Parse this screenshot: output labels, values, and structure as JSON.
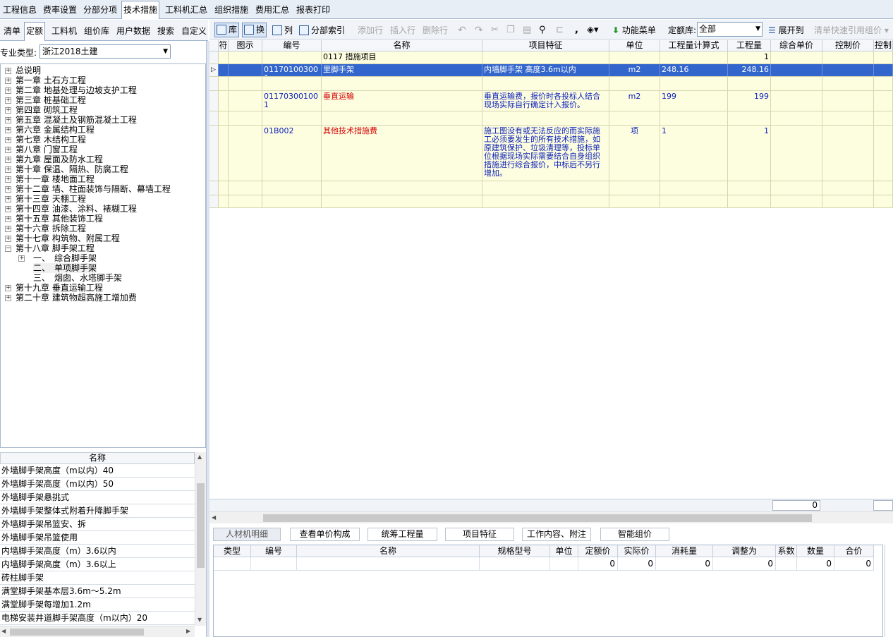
{
  "top_tabs": [
    "工程信息",
    "费率设置",
    "分部分项",
    "技术措施",
    "工料机汇总",
    "组织措施",
    "费用汇总",
    "报表打印"
  ],
  "left_tabs": [
    "清单",
    "定额",
    "工料机",
    "组价库",
    "用户数据",
    "搜索",
    "自定义"
  ],
  "specialty": {
    "label": "专业类型:",
    "value": "浙江2018土建"
  },
  "tree_items": [
    "总说明",
    "第一章 土石方工程",
    "第二章 地基处理与边坡支护工程",
    "第三章 桩基础工程",
    "第四章 砌筑工程",
    "第五章 混凝土及钢筋混凝土工程",
    "第六章 金属结构工程",
    "第七章 木结构工程",
    "第八章 门窗工程",
    "第九章 屋面及防水工程",
    "第十章 保温、隔热、防腐工程",
    "第十一章 楼地面工程",
    "第十二章 墙、柱面装饰与隔断、幕墙工程",
    "第十三章 天棚工程",
    "第十四章 油漆、涂料、裱糊工程",
    "第十五章 其他装饰工程",
    "第十六章 拆除工程",
    "第十七章 构筑物、附属工程",
    "第十八章 脚手架工程",
    "一、　综合脚手架",
    "二、　单项脚手架",
    "三、　烟囱、水塔脚手架",
    "第十九章 垂直运输工程",
    "第二十章 建筑物超高施工增加费"
  ],
  "list_header": "名称",
  "list_items": [
    "外墙脚手架高度（m以内）40",
    "外墙脚手架高度（m以内）50",
    "外墙脚手架悬挑式",
    "外墙脚手架整体式附着升降脚手架",
    "外墙脚手架吊篮安、拆",
    "外墙脚手架吊篮使用",
    "内墙脚手架高度（m）3.6以内",
    "内墙脚手架高度（m）3.6以上",
    "砖柱脚手架",
    "满堂脚手架基本层3.6m～5.2m",
    "满堂脚手架每增加1.2m",
    "电梯安装井道脚手架高度（m以内）20"
  ],
  "toolbar": {
    "ku": "库",
    "huan": "换",
    "lie": "列",
    "fenbu": "分部索引",
    "add": "添加行",
    "insert": "插入行",
    "delete": "删除行",
    "func": "功能菜单",
    "deku_label": "定额库:",
    "deku_value": "全部",
    "expand": "展开到",
    "quick": "清单快速引用组价"
  },
  "grid_headers": [
    "符",
    "图示",
    "编号",
    "名称",
    "项目特征",
    "单位",
    "工程量计算式",
    "工程量",
    "综合单价",
    "控制价",
    "控制"
  ],
  "grid_rows": [
    {
      "code": "",
      "name": "0117 措施项目",
      "feature": "",
      "unit": "",
      "formula": "",
      "qty": "1"
    },
    {
      "code": "011701003001",
      "name": "里脚手架",
      "feature": "内墙脚手架 高度3.6m以内",
      "unit": "m2",
      "formula": "248.16",
      "qty": "248.16"
    },
    {
      "code": "",
      "name": "",
      "feature": "",
      "unit": "",
      "formula": "",
      "qty": ""
    },
    {
      "code": "011703001001",
      "name": "垂直运输",
      "feature": "垂直运输费，报价时各投标人结合现场实际自行确定计入报价。",
      "unit": "m2",
      "formula": "199",
      "qty": "199"
    },
    {
      "code": "",
      "name": "",
      "feature": "",
      "unit": "",
      "formula": "",
      "qty": ""
    },
    {
      "code": "01B002",
      "name": "其他技术措施费",
      "feature": "施工图没有或无法反应的而实际施工必须要发生的所有技术措施，如原建筑保护、垃圾清理等，投标单位根据现场实际需要结合自身组织措施进行综合报价，中标后不另行增加。",
      "unit": "项",
      "formula": "1",
      "qty": "1"
    },
    {
      "code": "",
      "name": "",
      "feature": "",
      "unit": "",
      "formula": "",
      "qty": ""
    },
    {
      "code": "",
      "name": "",
      "feature": "",
      "unit": "",
      "formula": "",
      "qty": ""
    }
  ],
  "selected_row": 1,
  "sum_value": "0",
  "bottom_tabs": [
    "人材机明细",
    "查看单价构成",
    "统筹工程量",
    "项目特征",
    "工作内容、附注",
    "智能组价"
  ],
  "bottom_headers": [
    "类型",
    "编号",
    "名称",
    "规格型号",
    "单位",
    "定额价",
    "实际价",
    "消耗量",
    "调整为",
    "系数",
    "数量",
    "合价"
  ],
  "bottom_values": [
    "",
    "",
    "",
    "",
    "",
    "0",
    "0",
    "0",
    "0",
    "",
    "0",
    "0"
  ],
  "colors": {
    "selected": "#3366cc",
    "row_bg": "#fdfde0",
    "red_text": "#d40000",
    "blue_text": "#0a1fb8"
  }
}
